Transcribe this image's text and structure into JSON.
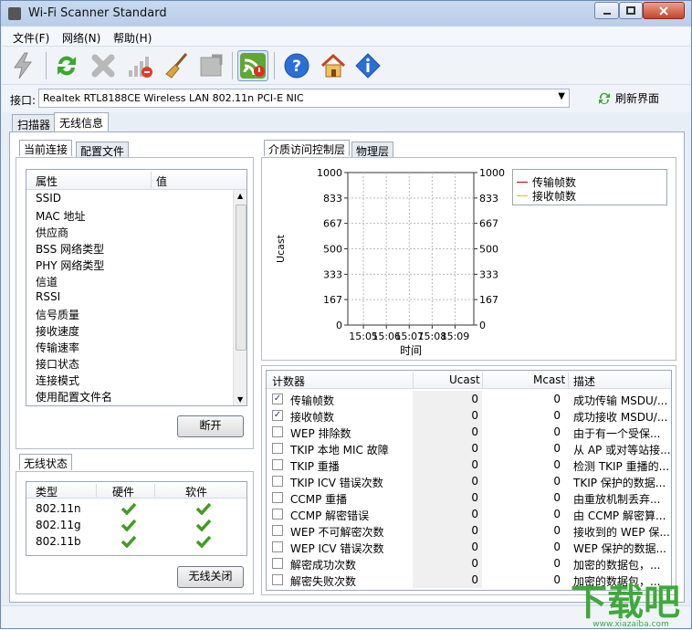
{
  "window": {
    "title": "Wi-Fi Scanner Standard",
    "min": "0",
    "max": "1",
    "close": "x"
  },
  "menu": [
    "文件(F)",
    "网络(N)",
    "帮助(H)"
  ],
  "toolbar": [
    "lightning-icon",
    "refresh-icon",
    "stop-icon",
    "signal-bars-icon",
    "broom-icon",
    "export-icon",
    "wifi-monitor-icon",
    "help-icon",
    "home-icon",
    "info-icon"
  ],
  "interface": {
    "label": "接口:",
    "value": "Realtek RTL8188CE Wireless LAN 802.11n PCI-E NIC",
    "refresh": "刷新界面"
  },
  "main_tabs": [
    "扫描器",
    "无线信息"
  ],
  "conn": {
    "tabs": [
      "当前连接",
      "配置文件"
    ],
    "header": {
      "attr": "属性",
      "val": "值"
    },
    "rows": [
      "SSID",
      "MAC 地址",
      "供应商",
      "BSS 网络类型",
      "PHY 网络类型",
      "信道",
      "RSSI",
      "信号质量",
      "接收速度",
      "传输速率",
      "接口状态",
      "连接模式",
      "使用配置文件名"
    ],
    "button": "断开"
  },
  "wireless": {
    "tab": "无线状态",
    "header": {
      "type": "类型",
      "hw": "硬件",
      "sw": "软件"
    },
    "rows": [
      "802.11n",
      "802.11g",
      "802.11b"
    ],
    "button": "无线关闭"
  },
  "graph_tabs": [
    "介质访问控制层",
    "物理层"
  ],
  "chart_data": {
    "type": "line",
    "x": [
      "15:05",
      "15:06",
      "15:07",
      "15:08",
      "15:09"
    ],
    "xlabel": "时间",
    "ylabel": "Ucast",
    "ylim": [
      0,
      1000
    ],
    "yticks": [
      "1000",
      "833",
      "667",
      "500",
      "333",
      "167",
      "0"
    ],
    "series": [
      {
        "name": "传输帧数",
        "color": "#c00000",
        "values": []
      },
      {
        "name": "接收帧数",
        "color": "#e6c000",
        "values": []
      }
    ],
    "grid": true,
    "legend": "top-right"
  },
  "counters": {
    "header": {
      "name": "计数器",
      "ucast": "Ucast",
      "mcast": "Mcast",
      "desc": "描述"
    },
    "rows": [
      {
        "checked": true,
        "name": "传输帧数",
        "u": "0",
        "m": "0",
        "d": "成功传输 MSDU/..."
      },
      {
        "checked": true,
        "name": "接收帧数",
        "u": "0",
        "m": "0",
        "d": "成功接收 MSDU/..."
      },
      {
        "checked": false,
        "name": "WEP 排除数",
        "u": "0",
        "m": "0",
        "d": "由于有一个受保..."
      },
      {
        "checked": false,
        "name": "TKIP 本地 MIC 故障",
        "u": "0",
        "m": "0",
        "d": "从 AP 或对等站接..."
      },
      {
        "checked": false,
        "name": "TKIP 重播",
        "u": "0",
        "m": "0",
        "d": "检测 TKIP 重播的..."
      },
      {
        "checked": false,
        "name": "TKIP ICV 错误次数",
        "u": "0",
        "m": "0",
        "d": "TKIP 保护的数据..."
      },
      {
        "checked": false,
        "name": "CCMP 重播",
        "u": "0",
        "m": "0",
        "d": "由重放机制丢弃..."
      },
      {
        "checked": false,
        "name": "CCMP 解密错误",
        "u": "0",
        "m": "0",
        "d": "由 CCMP 解密算..."
      },
      {
        "checked": false,
        "name": "WEP 不可解密次数",
        "u": "0",
        "m": "0",
        "d": "接收到的 WEP 保..."
      },
      {
        "checked": false,
        "name": "WEP ICV 错误次数",
        "u": "0",
        "m": "0",
        "d": "WEP 保护的数据..."
      },
      {
        "checked": false,
        "name": "解密成功次数",
        "u": "0",
        "m": "0",
        "d": "加密的数据包，..."
      },
      {
        "checked": false,
        "name": "解密失败次数",
        "u": "0",
        "m": "0",
        "d": "加密的数据包，..."
      }
    ]
  },
  "watermark": {
    "brand": "下载吧",
    "url": "www.xiazaiba.com"
  }
}
